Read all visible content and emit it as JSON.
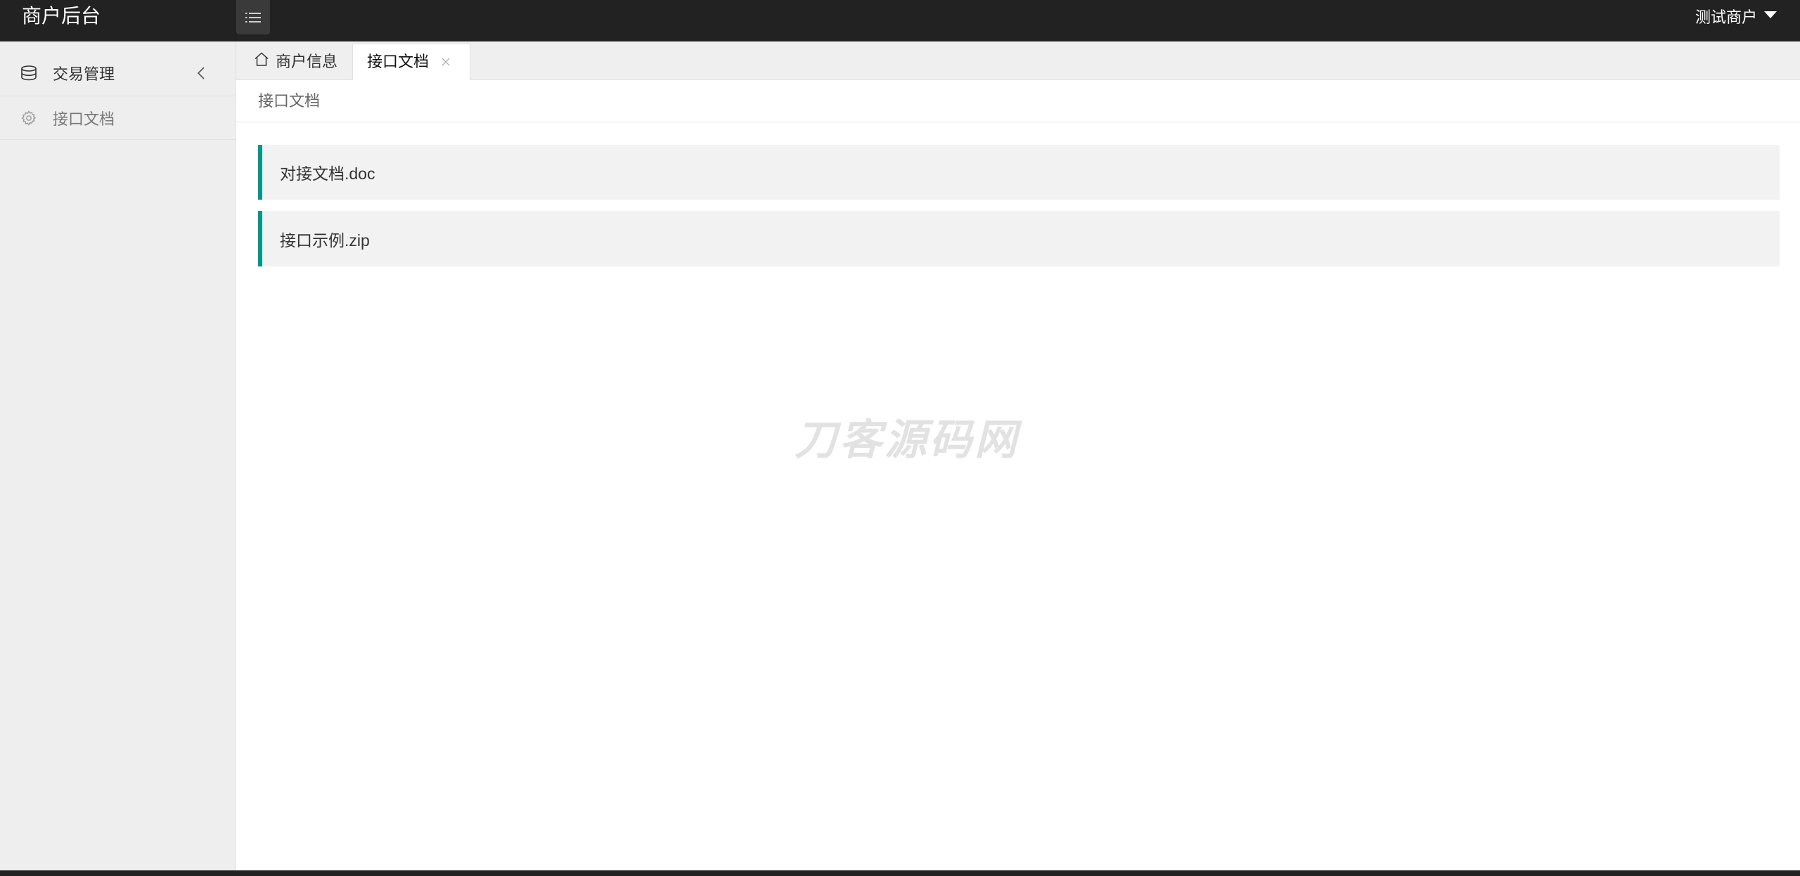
{
  "header": {
    "title": "商户后台",
    "menu_toggle_icon": "list-icon",
    "user_name": "测试商户",
    "user_dropdown_icon": "caret-down-icon"
  },
  "sidebar": {
    "items": [
      {
        "label": "交易管理",
        "icon": "database-icon",
        "expand_icon": "chevron-left-icon"
      },
      {
        "label": "接口文档",
        "icon": "gear-icon"
      }
    ]
  },
  "tabs": [
    {
      "label": "商户信息",
      "icon": "home-icon",
      "active": false
    },
    {
      "label": "接口文档",
      "active": true,
      "close_icon": "close-icon"
    }
  ],
  "breadcrumb": "接口文档",
  "files": [
    {
      "name": "对接文档.doc"
    },
    {
      "name": "接口示例.zip"
    }
  ],
  "watermark": "刀客源码网",
  "colors": {
    "header_bg": "#222222",
    "sidebar_bg": "#eeeeee",
    "tabbar_bg": "#efefef",
    "accent": "#009688",
    "file_bg": "#f2f2f2"
  }
}
